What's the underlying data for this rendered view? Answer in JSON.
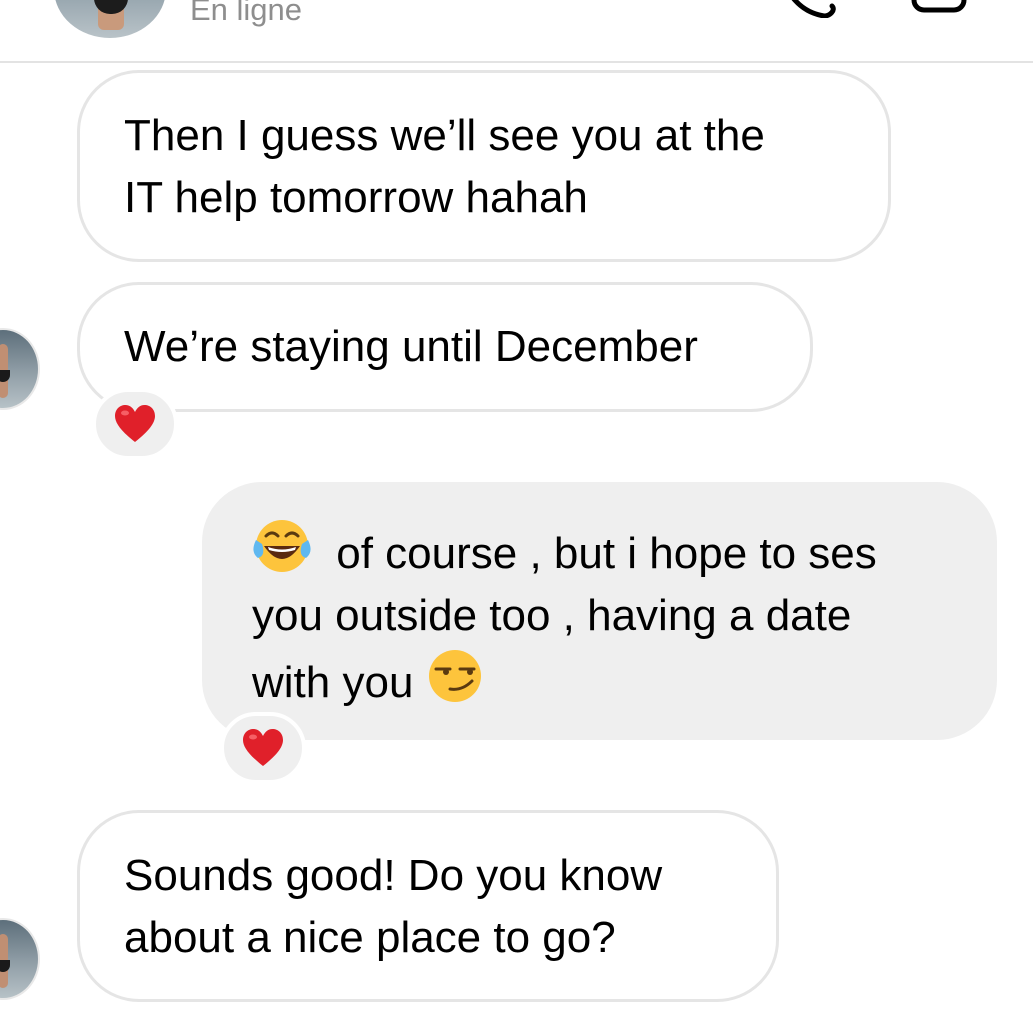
{
  "header": {
    "status": "En ligne"
  },
  "icons": {
    "call": "phone-icon",
    "video": "video-icon",
    "reaction": "heart-icon",
    "laugh": "tears-of-joy-emoji",
    "smirk": "smirking-face-emoji"
  },
  "colors": {
    "incoming_bubble_bg": "#ffffff",
    "incoming_bubble_border": "#e5e5e5",
    "outgoing_bubble_bg": "#efefef",
    "heart": "#e0202a",
    "status_text": "#8e8e8e"
  },
  "messages": [
    {
      "direction": "incoming",
      "lines": [
        "Then I guess we’ll see you at the",
        "IT help tomorrow hahah"
      ]
    },
    {
      "direction": "incoming",
      "lines": [
        "We’re staying until December"
      ],
      "reaction": "heart"
    },
    {
      "direction": "outgoing",
      "lines": [
        "of course , but i hope to ses",
        "you outside too , having a date",
        "with you"
      ],
      "reaction": "heart"
    },
    {
      "direction": "incoming",
      "lines": [
        "Sounds good! Do you know",
        "about a nice place to go?"
      ]
    }
  ]
}
